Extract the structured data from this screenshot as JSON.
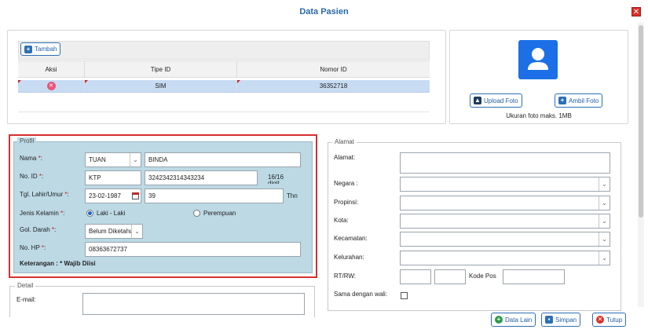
{
  "dialog": {
    "title": "Data Pasien",
    "close_symbol": "✕"
  },
  "id_grid": {
    "add_label": "Tambah",
    "columns": [
      "Aksi",
      "Tipe ID",
      "Nomor ID"
    ],
    "rows": [
      {
        "tipe": "SIM",
        "nomor": "36352718"
      }
    ]
  },
  "photo": {
    "upload_label": "Upload Foto",
    "capture_label": "Ambil Foto",
    "note": "Ukuran foto maks. 1MB"
  },
  "profil": {
    "legend": "Profil",
    "nama_label": "Nama",
    "nama_title": "TUAN",
    "nama_value": "BINDA",
    "noid_label": "No. ID",
    "noid_type": "KTP",
    "noid_value": "3242342314343234",
    "noid_count": "16/16",
    "noid_count_suffix": "digit",
    "tgl_label": "Tgl. Lahir/Umur",
    "tgl_value": "23-02-1987",
    "umur_value": "39",
    "umur_unit": "Thn",
    "jk_label": "Jenis Kelamin",
    "jk_male": "Laki - Laki",
    "jk_female": "Perempuan",
    "gol_label": "Gol. Darah",
    "gol_value": "Belum Diketahui",
    "hp_label": "No. HP",
    "hp_value": "08363672737",
    "ket_label": "Keterangan :",
    "ket_value": "* Wajib Diisi",
    "required_mark": "*",
    "colon": ":"
  },
  "alamat": {
    "legend": "Alamat",
    "alamat_label": "Alamat:",
    "negara_label": "Negara :",
    "propinsi_label": "Propinsi:",
    "kota_label": "Kota:",
    "kecamatan_label": "Kecamatan:",
    "kelurahan_label": "Kelurahan:",
    "rtrw_label": "RT/RW:",
    "kodepos_label": "Kode Pos",
    "wali_label": "Sama dengan wali:"
  },
  "detail": {
    "legend": "Detail",
    "email_label": "E-mail:"
  },
  "footer": {
    "data_lain_label": "Data Lain",
    "simpan_label": "Simpan",
    "tutup_label": "Tutup"
  },
  "colors": {
    "accent": "#2d6fb3",
    "profil_bg": "#bcd9e4",
    "highlight_border": "#d62f2f",
    "row_selected": "#c7dcf3"
  },
  "icons": {
    "tambah": "add-file-icon",
    "remove": "remove-circle-icon",
    "avatar": "user-avatar-icon",
    "upload": "upload-icon",
    "capture": "camera-file-icon",
    "calendar": "calendar-icon",
    "data_lain": "plus-circle-icon",
    "simpan": "save-icon",
    "tutup": "close-circle-icon"
  }
}
